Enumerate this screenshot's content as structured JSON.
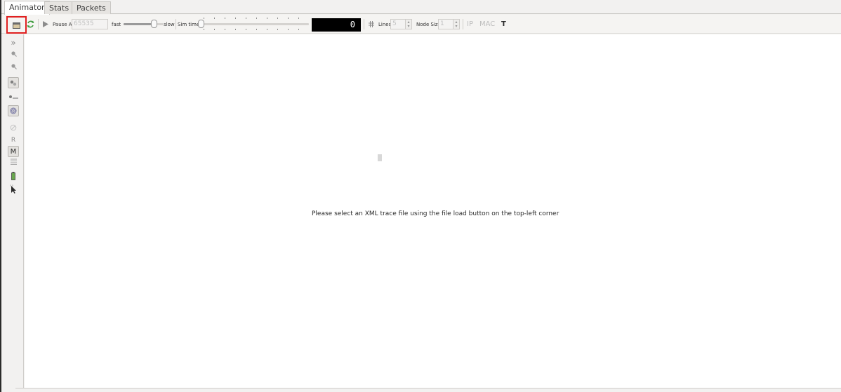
{
  "tabs": [
    {
      "label": "Animator"
    },
    {
      "label": "Stats"
    },
    {
      "label": "Packets"
    }
  ],
  "toolbar": {
    "pause_at_label": "Pause At",
    "pause_at_value": "65535",
    "fast_label": "fast",
    "slow_label": "slow",
    "sim_time_label": "Sim time",
    "sim_time_display": "0",
    "lines_label": "Lines",
    "lines_value": "5",
    "node_size_label": "Node Size",
    "node_size_value": "1",
    "ip_label": "IP",
    "mac_label": "MAC",
    "t_label": "T"
  },
  "sidebar": {
    "r_label": "R",
    "m_label": "M"
  },
  "canvas": {
    "message": "Please select an XML trace file using the file load button on the top-left corner"
  },
  "colors": {
    "highlight": "#e02020",
    "sim_time_bg": "#000000",
    "refresh_green": "#3a9a3a",
    "play_gray": "#8c8c8c"
  }
}
